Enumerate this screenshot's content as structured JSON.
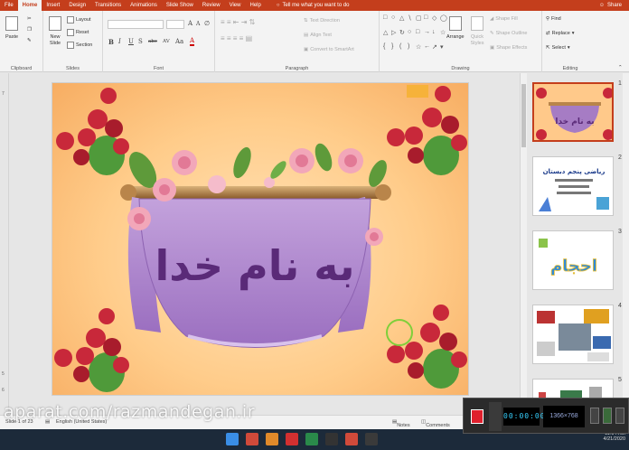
{
  "ribbon_tabs": [
    "File",
    "Home",
    "Insert",
    "Design",
    "Transitions",
    "Animations",
    "Slide Show",
    "Review",
    "View",
    "Help"
  ],
  "active_tab": "Home",
  "tell_me": "Tell me what you want to do",
  "share": "Share",
  "clipboard": {
    "paste": "Paste",
    "label": "Clipboard"
  },
  "slides_group": {
    "new_slide": "New Slide",
    "layout": "Layout",
    "reset": "Reset",
    "section": "Section",
    "label": "Slides"
  },
  "font_group": {
    "label": "Font",
    "bold": "B",
    "italic": "I",
    "underline": "U",
    "strike": "S",
    "shadow": "abc",
    "spacing": "AV",
    "case": "Aa",
    "grow": "A",
    "shrink": "A"
  },
  "paragraph_group": {
    "label": "Paragraph",
    "text_direction": "Text Direction",
    "align_text": "Align Text",
    "smartart": "Convert to SmartArt"
  },
  "drawing_group": {
    "label": "Drawing",
    "arrange": "Arrange",
    "quick_styles": "Quick Styles",
    "shape_fill": "Shape Fill",
    "shape_outline": "Shape Outline",
    "shape_effects": "Shape Effects"
  },
  "editing_group": {
    "label": "Editing",
    "find": "Find",
    "replace": "Replace",
    "select": "Select"
  },
  "slide": {
    "banner_text": "به نام خدا"
  },
  "thumbnails": [
    {
      "num": "1",
      "title": "به نام خدا",
      "selected": true
    },
    {
      "num": "2",
      "title": "ریاضی پنجم دبستان",
      "selected": false
    },
    {
      "num": "3",
      "title": "احجام",
      "selected": false
    },
    {
      "num": "4",
      "title": "",
      "selected": false
    },
    {
      "num": "5",
      "title": "",
      "selected": false
    }
  ],
  "status": {
    "slide_counter": "Slide 1 of 23",
    "language": "English (United States)",
    "notes": "Notes",
    "comments": "Comments"
  },
  "watermark": "aparat.com/razmandegan.ir",
  "recorder": {
    "timer": "00:00:00",
    "size": "1366×768"
  },
  "tray": {
    "time": "11:04 AM",
    "date": "4/21/2020"
  },
  "colors": {
    "accent": "#c43e1c",
    "slide_bg": "#ffcc8a",
    "banner": "#a67cc4",
    "banner_text": "#5a2a78",
    "rose": "#c8283a"
  }
}
